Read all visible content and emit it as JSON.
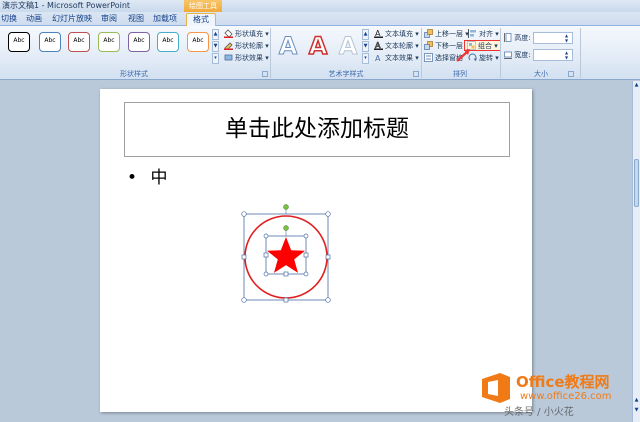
{
  "window": {
    "title": "演示文稿1 - Microsoft PowerPoint",
    "context_tools_label": "绘图工具"
  },
  "tabs": [
    {
      "label": "切换"
    },
    {
      "label": "动画"
    },
    {
      "label": "幻灯片放映"
    },
    {
      "label": "审阅"
    },
    {
      "label": "视图"
    },
    {
      "label": "加载项"
    },
    {
      "label": "格式",
      "active": true
    }
  ],
  "ribbon": {
    "shape_styles": {
      "group_label": "形状样式",
      "swatch_text": "Abc",
      "swatch_colors": [
        "#000000",
        "#4f81bd",
        "#c0504d",
        "#9bbb59",
        "#8064a2",
        "#4bacc6",
        "#f79646"
      ],
      "fill_label": "形状填充",
      "outline_label": "形状轮廓",
      "effects_label": "形状效果"
    },
    "wordart": {
      "group_label": "艺术字样式",
      "letter": "A",
      "text_fill_label": "文本填充",
      "text_outline_label": "文本轮廓",
      "text_effects_label": "文本效果"
    },
    "arrange": {
      "group_label": "排列",
      "bring_forward_label": "上移一层",
      "send_backward_label": "下移一层",
      "selection_pane_label": "选择窗格",
      "align_label": "对齐",
      "group_label_btn": "组合",
      "rotate_label": "旋转"
    },
    "size": {
      "group_label": "大小",
      "height_label": "高度:",
      "width_label": "宽度:"
    }
  },
  "slide": {
    "title_placeholder": "单击此处添加标题",
    "bullet_symbol": "•",
    "bullet_text": "中"
  },
  "colors": {
    "circle": "#e02020",
    "star": "#ff0000",
    "selection": "#4a6fa5",
    "rotation_handle": "#7ac142"
  },
  "watermark": {
    "name": "Office教程网",
    "url": "www.office26.com",
    "caption": "头条号 / 小火花"
  }
}
